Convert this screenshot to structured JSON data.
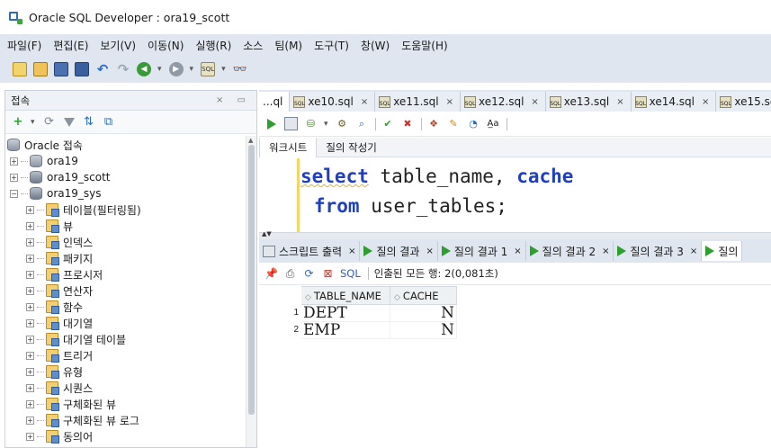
{
  "window": {
    "title": "Oracle SQL Developer : ora19_scott"
  },
  "menu": [
    "파일(F)",
    "편집(E)",
    "보기(V)",
    "이동(N)",
    "실행(R)",
    "소스",
    "팀(M)",
    "도구(T)",
    "창(W)",
    "도움말(H)"
  ],
  "connections_panel": {
    "title": "접속",
    "tree": [
      {
        "label": "Oracle 접속",
        "level": 0,
        "icon": "database-icon"
      },
      {
        "label": "ora19",
        "level": 1,
        "icon": "database-icon"
      },
      {
        "label": "ora19_scott",
        "level": 1,
        "icon": "connection-icon"
      },
      {
        "label": "ora19_sys",
        "level": 1,
        "icon": "connection-icon"
      },
      {
        "label": "테이블(필터링됨)",
        "level": 2,
        "icon": "folder-icon"
      },
      {
        "label": "뷰",
        "level": 2,
        "icon": "folder-icon"
      },
      {
        "label": "인덱스",
        "level": 2,
        "icon": "folder-icon"
      },
      {
        "label": "패키지",
        "level": 2,
        "icon": "folder-icon"
      },
      {
        "label": "프로시저",
        "level": 2,
        "icon": "folder-icon"
      },
      {
        "label": "연산자",
        "level": 2,
        "icon": "folder-icon"
      },
      {
        "label": "함수",
        "level": 2,
        "icon": "folder-icon"
      },
      {
        "label": "대기열",
        "level": 2,
        "icon": "folder-icon"
      },
      {
        "label": "대기열 테이블",
        "level": 2,
        "icon": "folder-icon"
      },
      {
        "label": "트리거",
        "level": 2,
        "icon": "folder-icon"
      },
      {
        "label": "유형",
        "level": 2,
        "icon": "folder-icon"
      },
      {
        "label": "시퀀스",
        "level": 2,
        "icon": "folder-icon"
      },
      {
        "label": "구체화된 뷰",
        "level": 2,
        "icon": "folder-icon"
      },
      {
        "label": "구체화된 뷰 로그",
        "level": 2,
        "icon": "folder-icon"
      },
      {
        "label": "동의어",
        "level": 2,
        "icon": "folder-icon"
      }
    ]
  },
  "doc_tabs": [
    {
      "label": "...ql",
      "active": true
    },
    {
      "label": "xe10.sql"
    },
    {
      "label": "xe11.sql"
    },
    {
      "label": "xe12.sql"
    },
    {
      "label": "xe13.sql"
    },
    {
      "label": "xe14.sql"
    },
    {
      "label": "xe15.sq"
    }
  ],
  "worksheet_tabs": [
    "워크시트",
    "질의 작성기"
  ],
  "editor": {
    "line1": {
      "kw1": "select",
      "mid": " table_name, ",
      "kw2": "cache"
    },
    "line2": {
      "kw1": "from",
      "rest": " user_tables;"
    }
  },
  "result_tabs": [
    {
      "label": "스크립트 출력",
      "type": "script"
    },
    {
      "label": "질의 결과",
      "type": "query"
    },
    {
      "label": "질의 결과 1",
      "type": "query"
    },
    {
      "label": "질의 결과 2",
      "type": "query"
    },
    {
      "label": "질의 결과 3",
      "type": "query"
    },
    {
      "label": "질의",
      "type": "query"
    }
  ],
  "result_toolbar": {
    "sql_link": "SQL",
    "fetch_status": "인출된 모든 행: 2(0,081초)"
  },
  "grid": {
    "columns": [
      "TABLE_NAME",
      "CACHE"
    ],
    "rows": [
      {
        "num": "1",
        "table_name": "DEPT",
        "cache": "N"
      },
      {
        "num": "2",
        "table_name": "EMP",
        "cache": "N"
      }
    ]
  },
  "colors": {
    "keyword": "#1f3fbd",
    "chrome": "#dfe6ef",
    "run": "#2e9e2e"
  }
}
